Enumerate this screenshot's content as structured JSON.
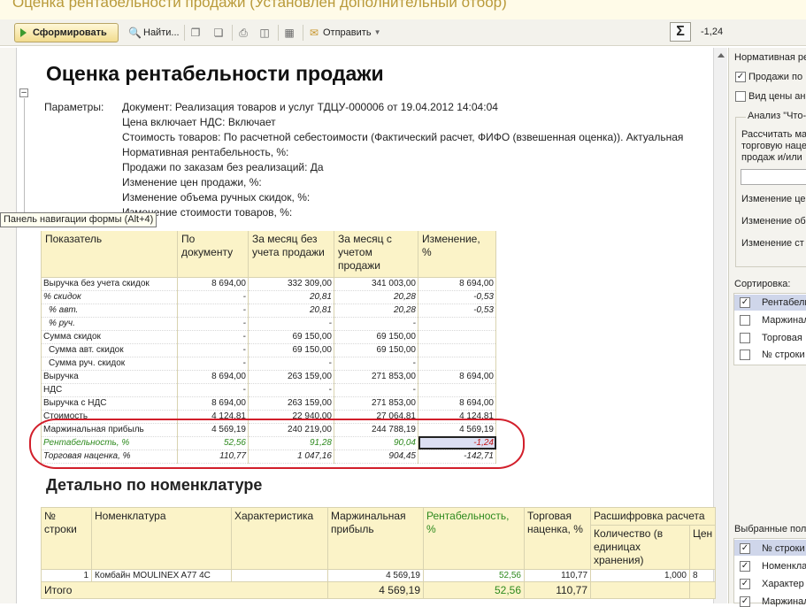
{
  "window": {
    "title": "Оценка рентабельности продажи (Установлен дополнительный отбор)"
  },
  "toolbar": {
    "generate_label": "Сформировать",
    "find_label": "Найти...",
    "send_label": "Отправить",
    "sum_value": "-1,24"
  },
  "tooltip": "Панель навигации формы (Alt+4)",
  "report": {
    "title": "Оценка рентабельности продажи",
    "params_label": "Параметры:",
    "params": [
      "Документ: Реализация товаров и услуг ТДЦУ-000006 от 19.04.2012 14:04:04",
      "Цена включает НДС: Включает",
      "Стоимость товаров: По расчетной себестоимости (Фактический расчет, ФИФО (взвешенная оценка)). Актуальная",
      "Нормативная рентабельность, %:",
      "Продажи по заказам без реализаций: Да",
      "Изменение цен продажи, %:",
      "Изменение объема ручных скидок, %:",
      "Изменение стоимости товаров, %:"
    ],
    "table": {
      "headers": [
        "Показатель",
        "По документу",
        "За месяц без учета продажи",
        "За месяц с учетом продажи",
        "Изменение, %"
      ],
      "rows": [
        {
          "label": "Выручка без учета скидок",
          "v": [
            "8 694,00",
            "332 309,00",
            "341 003,00",
            "8 694,00"
          ]
        },
        {
          "label": "% скидок",
          "v": [
            "-",
            "20,81",
            "20,28",
            "-0,53"
          ]
        },
        {
          "label": "% авт.",
          "v": [
            "-",
            "20,81",
            "20,28",
            "-0,53"
          ]
        },
        {
          "label": "% руч.",
          "v": [
            "-",
            "-",
            "-",
            ""
          ]
        },
        {
          "label": "Сумма скидок",
          "v": [
            "-",
            "69 150,00",
            "69 150,00",
            ""
          ]
        },
        {
          "label": "Сумма авт. скидок",
          "v": [
            "-",
            "69 150,00",
            "69 150,00",
            ""
          ]
        },
        {
          "label": "Сумма руч. скидок",
          "v": [
            "-",
            "-",
            "-",
            ""
          ]
        },
        {
          "label": "Выручка",
          "v": [
            "8 694,00",
            "263 159,00",
            "271 853,00",
            "8 694,00"
          ]
        },
        {
          "label": "НДС",
          "v": [
            "-",
            "-",
            "-",
            ""
          ]
        },
        {
          "label": "Выручка с НДС",
          "v": [
            "8 694,00",
            "263 159,00",
            "271 853,00",
            "8 694,00"
          ]
        },
        {
          "label": "Стоимость",
          "v": [
            "4 124,81",
            "22 940,00",
            "27 064,81",
            "4 124,81"
          ]
        },
        {
          "label": "Маржинальная прибыль",
          "v": [
            "4 569,19",
            "240 219,00",
            "244 788,19",
            "4 569,19"
          ]
        },
        {
          "label": "Рентабельность, %",
          "v": [
            "52,56",
            "91,28",
            "90,04",
            "-1,24"
          ]
        },
        {
          "label": "Торговая наценка, %",
          "v": [
            "110,77",
            "1 047,16",
            "904,45",
            "-142,71"
          ]
        }
      ]
    },
    "detail": {
      "title": "Детально по номенклатуре",
      "headers": {
        "num": "№ строки",
        "item": "Номенклатура",
        "char": "Характеристика",
        "margin": "Маржинальная прибыль",
        "profit": "Рентабельность, %",
        "markup": "Торговая наценка, %",
        "decode": "Расшифровка расчета",
        "qty": "Количество (в единицах хранения)",
        "price": "Цен"
      },
      "row": {
        "num": "1",
        "item": "Комбайн MOULINEX A77 4C",
        "char": "",
        "margin": "4 569,19",
        "profit": "52,56",
        "markup": "110,77",
        "qty": "1,000",
        "price": "8"
      },
      "total": {
        "label": "Итого",
        "margin": "4 569,19",
        "profit": "52,56",
        "markup": "110,77"
      }
    }
  },
  "right_panel": {
    "norm_label": "Нормативная ре",
    "sales_label": "Продажи по",
    "price_type_label": "Вид цены ана",
    "analysis_label": "Анализ \"Что-",
    "calc_text": [
      "Рассчитать ма",
      "торговую наце",
      "продаж и/или"
    ],
    "change_labels": [
      "Изменение це",
      "Изменение об",
      "Изменение ст"
    ],
    "sort_label": "Сортировка:",
    "sort_items": [
      "Рентабельн",
      "Маржинал",
      "Торговая",
      "№ строки"
    ],
    "fields_label": "Выбранные пол",
    "field_items": [
      "№ строки",
      "Номенкла",
      "Характер",
      "Маржинал"
    ]
  },
  "colors": {
    "accent_green": "#2e8a1e",
    "accent_red": "#c21414",
    "header_bg": "#fbf3c8",
    "ellipse": "#d21f2b"
  }
}
